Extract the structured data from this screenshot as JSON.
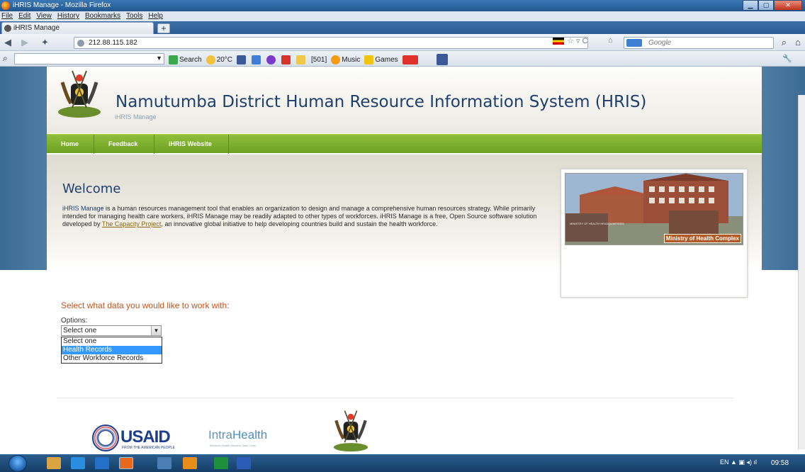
{
  "window": {
    "title": "iHRIS Manage - Mozilla Firefox"
  },
  "menu": [
    "File",
    "Edit",
    "View",
    "History",
    "Bookmarks",
    "Tools",
    "Help"
  ],
  "tab": {
    "label": "iHRIS Manage",
    "new_tab": "+"
  },
  "address": {
    "url": "212.88.115.182"
  },
  "search": {
    "placeholder": "Google"
  },
  "toolbar": {
    "search_label": "Search",
    "weather": "20°C",
    "count": "[501]",
    "music": "Music",
    "games": "Games"
  },
  "site": {
    "title": "Namutumba District Human Resource Information System (HRIS)",
    "subtitle": "iHRIS Manage",
    "nav": [
      "Home",
      "Feedback",
      "iHRIS Website"
    ]
  },
  "welcome": {
    "heading": "Welcome",
    "p1_link": "iHRIS Manage",
    "p1_text": " is a human resources management tool that enables an organization to design and manage a comprehensive human resources strategy. While primarily intended for managing health care workers, iHRIS Manage may be readily adapted to other types of workforces. iHRIS Manage is a free, Open Source software solution developed by ",
    "p1_link2": "The Capacity Project",
    "p1_text2": ", an innovative global initiative to help developing countries build and sustain the health workforce.",
    "photo_caption": "Ministry of Health Complex",
    "photo_sign": "MINISTRY OF HEALTH HEADQUARTERS"
  },
  "selector": {
    "heading": "Select what data you would like to work with:",
    "label": "Options:",
    "current": "Select one",
    "options": [
      "Select one",
      "Health Records",
      "Other Workforce Records"
    ],
    "highlighted_index": 1
  },
  "footer": {
    "usaid": "USAID",
    "usaid_sub": "FROM THE AMERICAN PEOPLE",
    "intra_a": "Intra",
    "intra_b": "Health",
    "intra_sub": "Because Health Workers Save Lives"
  },
  "taskbar": {
    "lang": "EN",
    "time": "09:58"
  },
  "colors": {
    "nav_green": "#7aab2c",
    "title_blue": "#1f3f6e",
    "select_heading": "#c9511b",
    "highlight": "#3399ff"
  }
}
